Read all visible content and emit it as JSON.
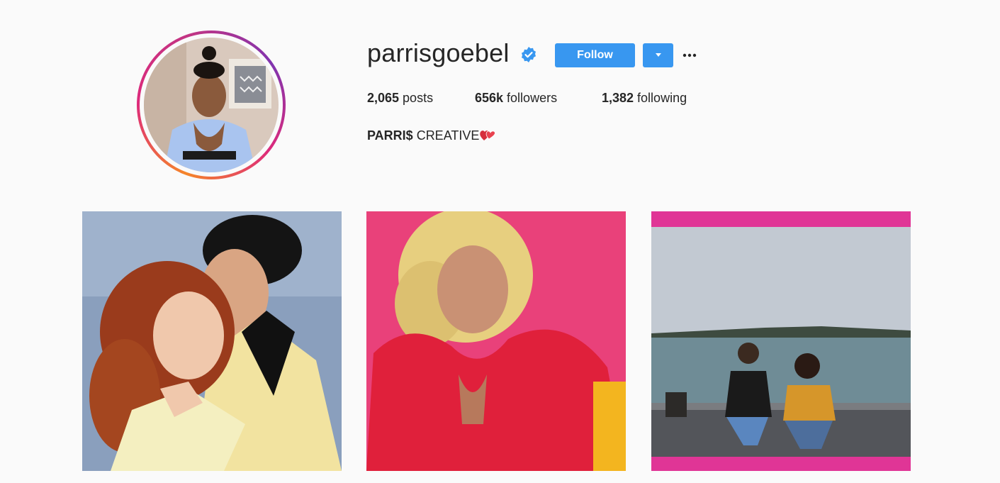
{
  "profile": {
    "username": "parrisgoebel",
    "verified_icon": "verified-badge-icon",
    "follow_label": "Follow",
    "dropdown_icon": "caret-down-icon",
    "more_icon": "more-options-icon",
    "bio_name": "PARRI$",
    "bio_text": " CREATIVE",
    "bio_emoji": "two-hearts-icon"
  },
  "stats": {
    "posts_count": "2,065",
    "posts_label": " posts",
    "followers_count": "656k",
    "followers_label": " followers",
    "following_count": "1,382",
    "following_label": " following"
  },
  "colors": {
    "accent": "#3897f0",
    "text": "#262626",
    "background": "#fafafa",
    "ring_start": "#f58529",
    "ring_end": "#c13584"
  },
  "posts": [
    {
      "subject": "retro couple embrace photo"
    },
    {
      "subject": "woman in red fur coat on pink background"
    },
    {
      "subject": "two women posing by harbor"
    }
  ]
}
